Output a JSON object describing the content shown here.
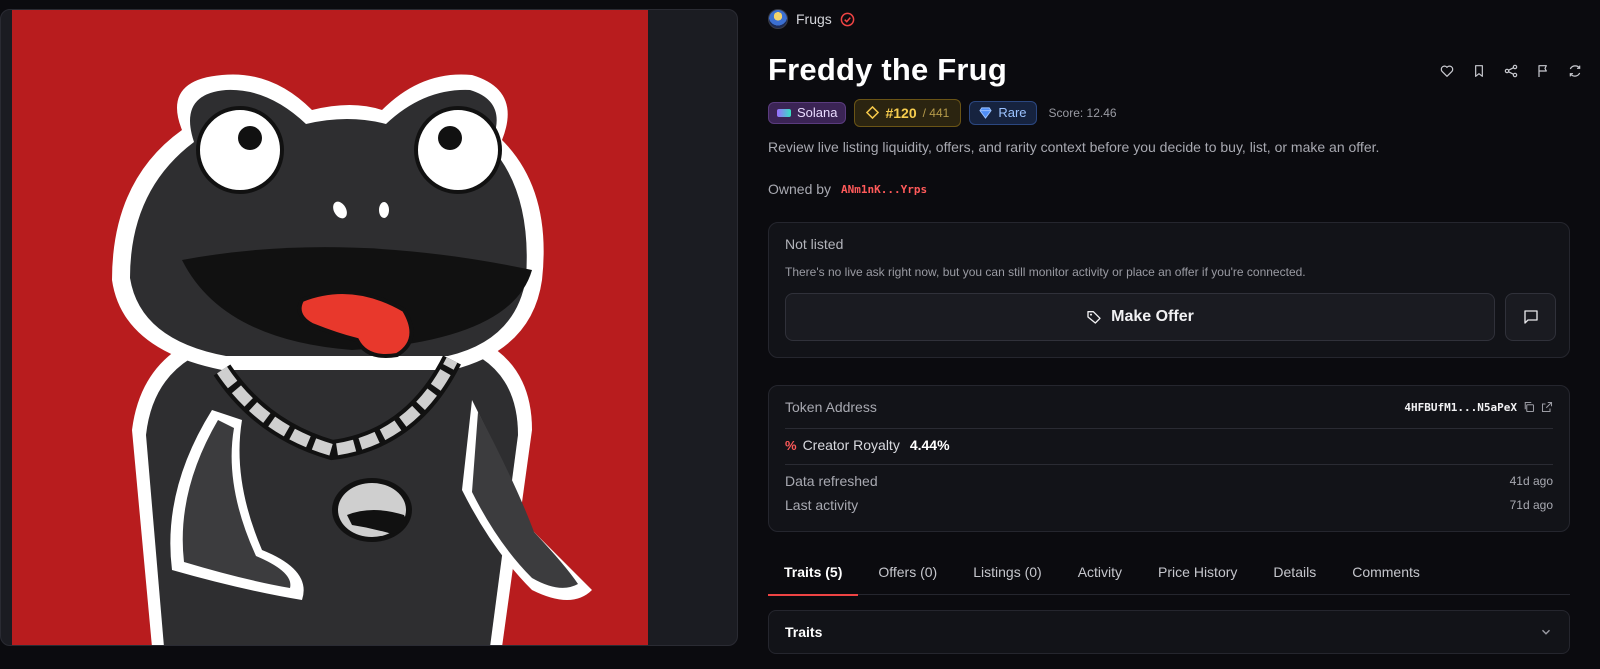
{
  "collection": {
    "name": "Frugs",
    "avatar_icon": "frugs-avatar",
    "verified_icon": "verified-check-icon"
  },
  "nft": {
    "title": "Freddy the Frug",
    "chain": "Solana",
    "rank": "#120",
    "rank_total": "/ 441",
    "rarity": "Rare",
    "score": "Score: 12.46",
    "description": "Review live listing liquidity, offers, and rarity context before you decide to buy, list, or make an offer.",
    "owner_label": "Owned by",
    "owner_address": "ANm1nK...Yrps"
  },
  "actions": [
    "heart-icon",
    "bookmark-icon",
    "share-icon",
    "flag-icon",
    "refresh-icon"
  ],
  "listing": {
    "status": "Not listed",
    "note": "There's no live ask right now, but you can still monitor activity or place an offer if you're connected.",
    "make_offer_label": "Make Offer"
  },
  "info": {
    "token_label": "Token Address",
    "token_address": "4HFBUfM1...N5aPeX",
    "royalty_icon": "%",
    "royalty_label": "Creator Royalty",
    "royalty_value": "4.44%",
    "refreshed_label": "Data refreshed",
    "refreshed_value": "41d ago",
    "activity_label": "Last activity",
    "activity_value": "71d ago"
  },
  "tabs": [
    {
      "label": "Traits (5)",
      "active": true
    },
    {
      "label": "Offers (0)",
      "active": false
    },
    {
      "label": "Listings (0)",
      "active": false
    },
    {
      "label": "Activity",
      "active": false
    },
    {
      "label": "Price History",
      "active": false
    },
    {
      "label": "Details",
      "active": false
    },
    {
      "label": "Comments",
      "active": false
    }
  ],
  "traits_panel": {
    "title": "Traits"
  },
  "colors": {
    "background": "#0b0b0f",
    "art_background": "#b81c1e",
    "accent": "#ef4444",
    "rank": "#f7cd4e",
    "rare": "#9cc3ff"
  }
}
